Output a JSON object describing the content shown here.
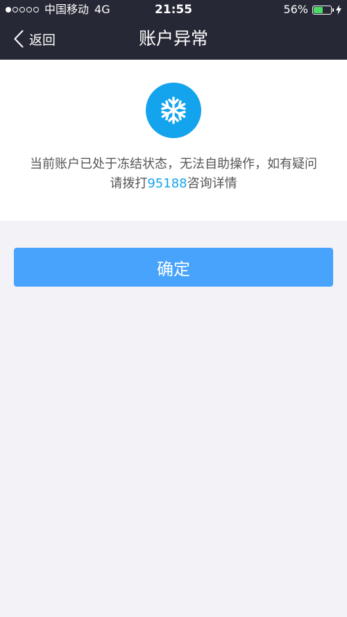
{
  "status_bar": {
    "carrier": "中国移动",
    "network": "4G",
    "time": "21:55",
    "battery_percent": "56%",
    "battery_level": 0.56,
    "signal_filled": 1,
    "signal_total": 5
  },
  "nav": {
    "back_label": "返回",
    "title": "账户异常"
  },
  "notice": {
    "icon": "snowflake-icon",
    "message_part1": "当前账户已处于冻结状态，无法自助操作，如有疑问请拨打",
    "phone": "95188",
    "message_part2": "咨询详情"
  },
  "confirm_label": "确定",
  "colors": {
    "nav_background": "#262835",
    "accent_blue": "#13a4ed",
    "button_blue": "#47a3fb",
    "page_background": "#f2f2f7",
    "battery_green": "#4cd964"
  }
}
